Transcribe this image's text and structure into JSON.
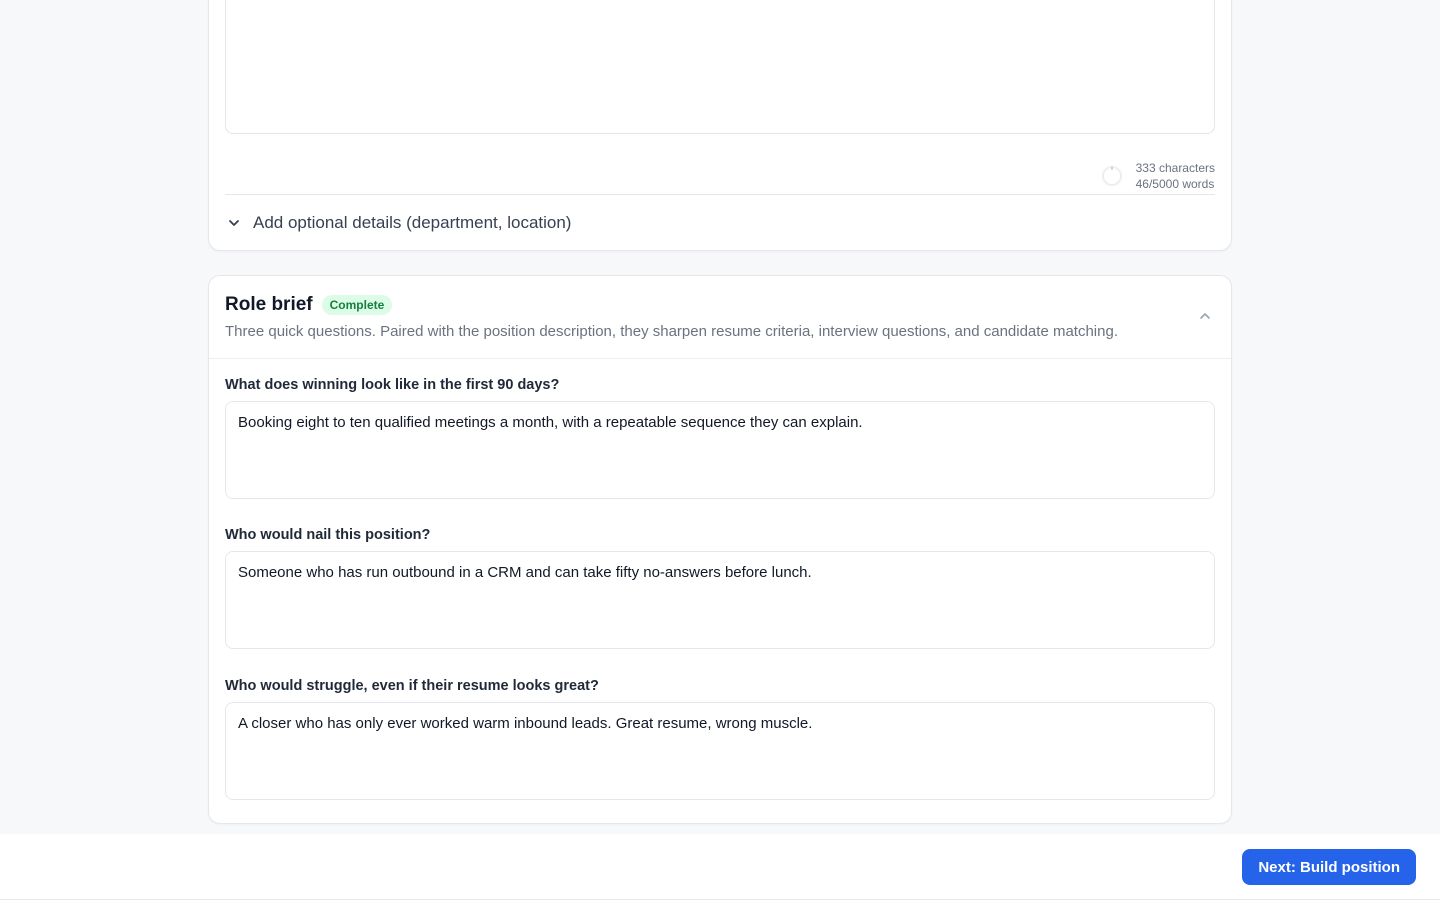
{
  "description_card": {
    "description_text": "",
    "char_count": "333 characters",
    "word_count": "46/5000 words",
    "optional_details_label": "Add optional details (department, location)",
    "chevron_icon": "chevron-down-icon"
  },
  "role_brief": {
    "title": "Role brief",
    "status_badge": "Complete",
    "status_color": "#15803d",
    "subtitle": "Three quick questions. Paired with the position description, they sharpen resume criteria, interview questions, and candidate matching.",
    "collapse_icon": "chevron-up-icon",
    "questions": [
      {
        "label": "What does winning look like in the first 90 days?",
        "answer": "Booking eight to ten qualified meetings a month, with a repeatable sequence they can explain."
      },
      {
        "label": "Who would nail this position?",
        "answer": "Someone who has run outbound in a CRM and can take fifty no-answers before lunch."
      },
      {
        "label": "Who would struggle, even if their resume looks great?",
        "answer": "A closer who has only ever worked warm inbound leads. Great resume, wrong muscle."
      }
    ]
  },
  "footer": {
    "next_label": "Next: Build position",
    "accent_color": "#2563eb"
  }
}
